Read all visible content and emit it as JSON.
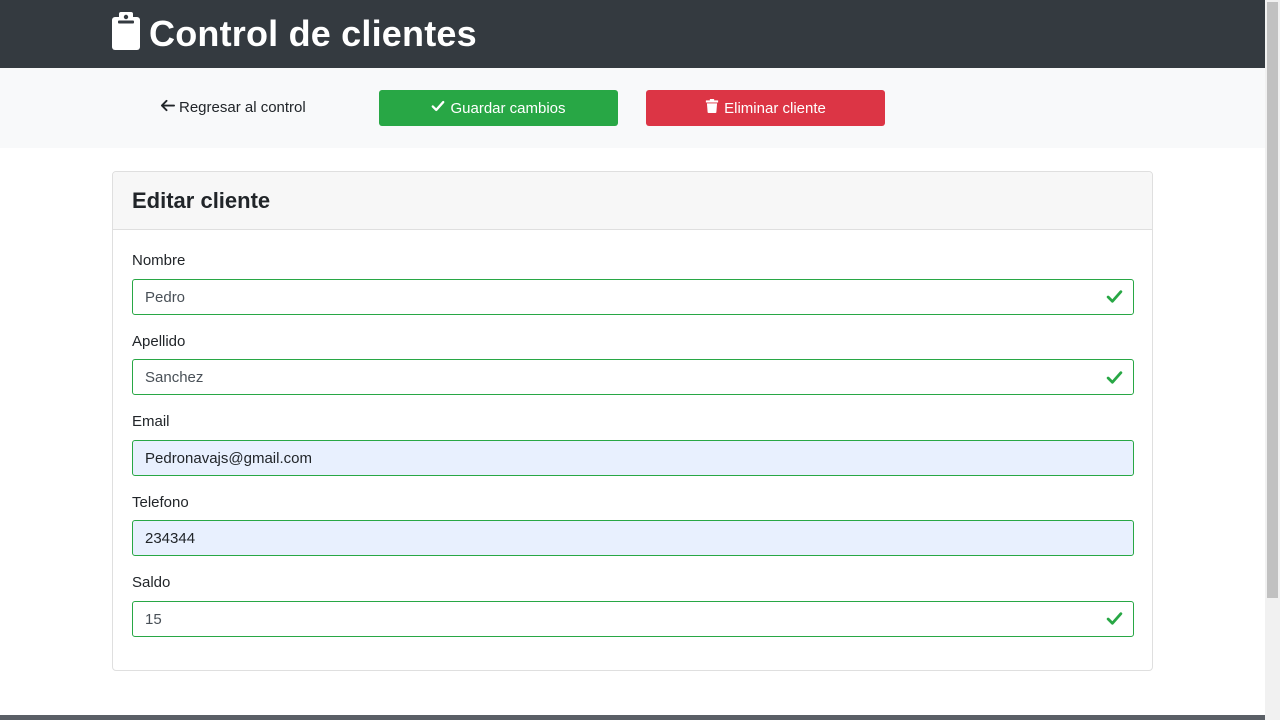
{
  "header": {
    "title": "Control de clientes",
    "icon": "clipboard-icon"
  },
  "toolbar": {
    "back_label": "Regresar al control",
    "save_label": "Guardar cambios",
    "delete_label": "Eliminar cliente"
  },
  "form": {
    "title": "Editar cliente",
    "fields": [
      {
        "label": "Nombre",
        "value": "Pedro",
        "valid": true
      },
      {
        "label": "Apellido",
        "value": "Sanchez",
        "valid": true
      },
      {
        "label": "Email",
        "value": "Pedronavajs@gmail.com",
        "valid": false
      },
      {
        "label": "Telefono",
        "value": "234344",
        "valid": false
      },
      {
        "label": "Saldo",
        "value": "15",
        "valid": true
      }
    ]
  },
  "colors": {
    "navbar": "#343a40",
    "success": "#28a745",
    "danger": "#dc3545",
    "autofill": "#e8f0fe"
  }
}
